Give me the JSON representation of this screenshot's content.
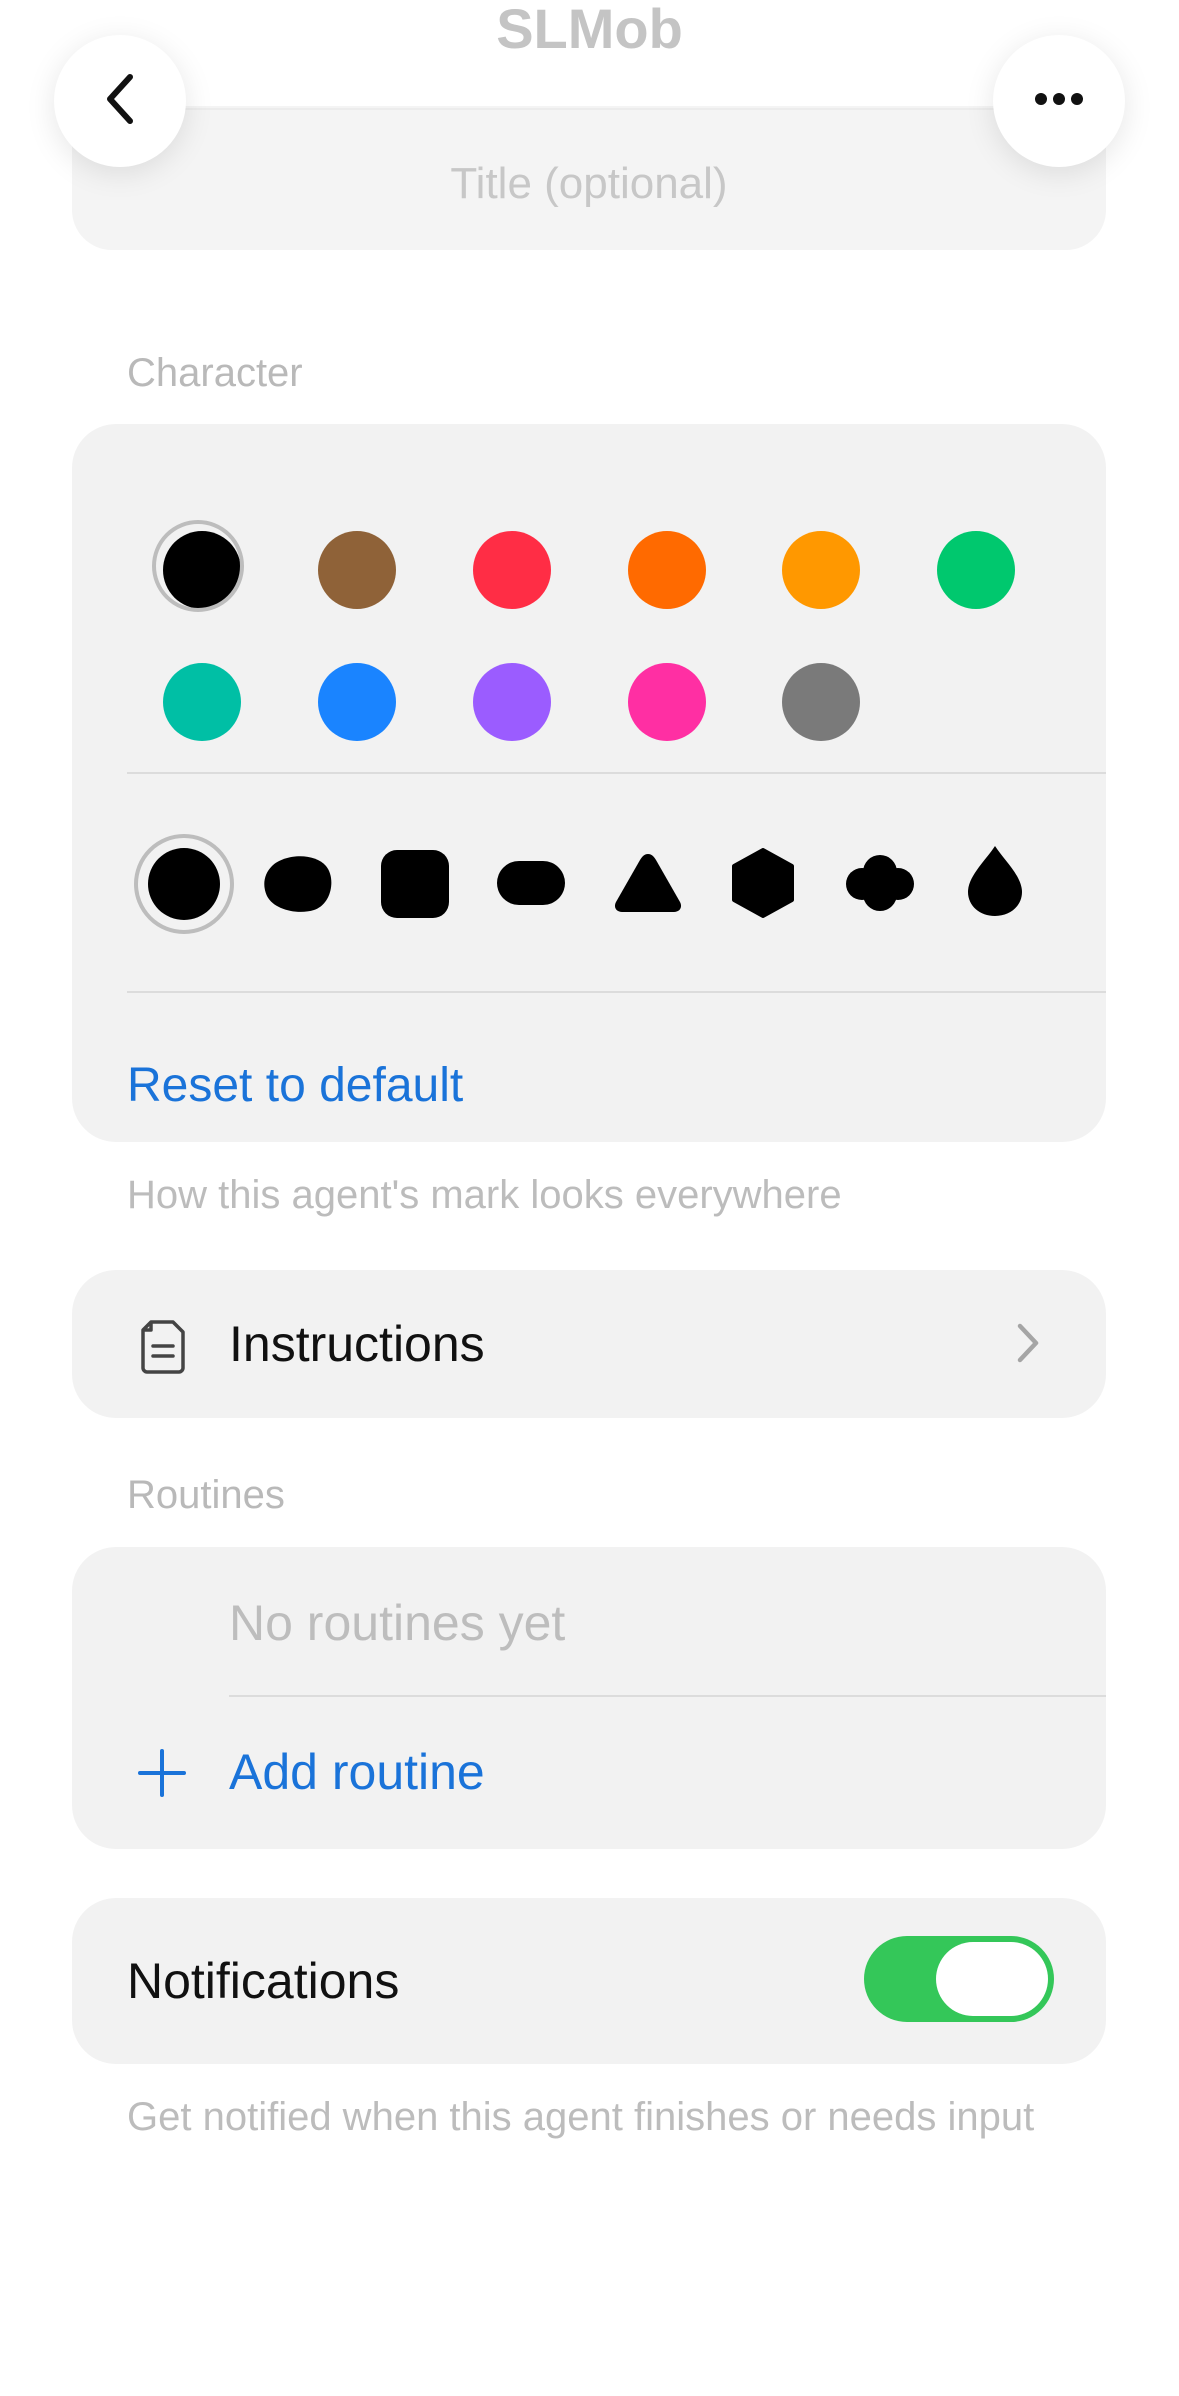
{
  "header": {
    "app_title": "SLMob",
    "title_placeholder": "Title (optional)",
    "back_icon": "chevron-left-icon",
    "more_icon": "ellipsis-icon"
  },
  "character": {
    "section_label": "Character",
    "colors": [
      "#000000",
      "#8f6238",
      "#ff2d45",
      "#ff6a00",
      "#ff9800",
      "#00c86e",
      "#00bfa5",
      "#1a84ff",
      "#9b5cff",
      "#ff2fa3",
      "#7a7a7a"
    ],
    "selected_color": "#000000",
    "shapes": [
      "circle-shape-icon",
      "blob-shape-icon",
      "rounded-square-shape-icon",
      "pill-shape-icon",
      "triangle-shape-icon",
      "hexagon-shape-icon",
      "cloud-shape-icon",
      "drop-shape-icon"
    ],
    "selected_shape": "circle-shape-icon",
    "reset_label": "Reset to default",
    "footnote": "How this agent's mark looks everywhere"
  },
  "instructions": {
    "label": "Instructions",
    "icon": "document-icon",
    "chevron": "chevron-right-icon"
  },
  "routines": {
    "section_label": "Routines",
    "empty_text": "No routines yet",
    "add_label": "Add routine",
    "add_icon": "plus-icon"
  },
  "notifications": {
    "label": "Notifications",
    "enabled": true,
    "footnote": "Get notified when this agent finishes or needs input"
  },
  "colors": {
    "accent": "#1a73d9",
    "toggle_on": "#34c759"
  }
}
